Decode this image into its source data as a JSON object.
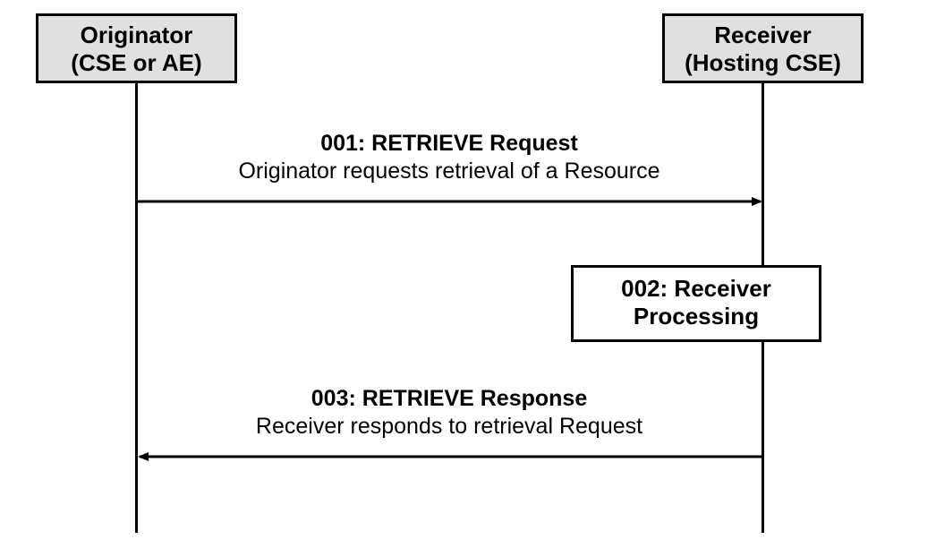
{
  "participants": {
    "originator": {
      "line1": "Originator",
      "line2": "(CSE or AE)"
    },
    "receiver": {
      "line1": "Receiver",
      "line2": "(Hosting CSE)"
    }
  },
  "messages": {
    "msg1": {
      "title": "001: RETRIEVE Request",
      "desc": "Originator requests retrieval of  a Resource"
    },
    "process": {
      "line1": "002: Receiver",
      "line2": "Processing"
    },
    "msg3": {
      "title": "003: RETRIEVE Response",
      "desc": "Receiver responds to retrieval Request"
    }
  }
}
